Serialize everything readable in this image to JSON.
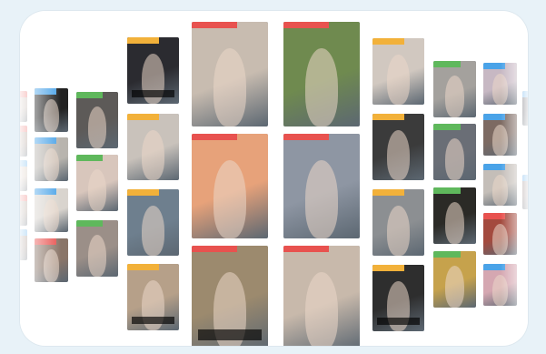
{
  "gallery": {
    "tiles": [
      {
        "name": "thumb-col0-1",
        "tag": "",
        "tag_color": "red",
        "bg": "#b7a59a"
      },
      {
        "name": "thumb-col0-2",
        "tag": "",
        "tag_color": "red",
        "bg": "#9a8074"
      },
      {
        "name": "thumb-col0-3",
        "tag": "",
        "tag_color": "blue",
        "bg": "#c9b6a7"
      },
      {
        "name": "thumb-col0-4",
        "tag": "",
        "tag_color": "red",
        "bg": "#a08d80"
      },
      {
        "name": "thumb-col0-5",
        "tag": "",
        "tag_color": "blue",
        "bg": "#8f7a6e"
      },
      {
        "name": "thumb-col1-1",
        "tag": "",
        "tag_color": "blue",
        "bg": "#222222"
      },
      {
        "name": "thumb-col1-2",
        "tag": "",
        "tag_color": "blue",
        "bg": "#b8b4ae"
      },
      {
        "name": "thumb-col1-3",
        "tag": "",
        "tag_color": "blue",
        "bg": "#d9d4ce"
      },
      {
        "name": "thumb-col1-4",
        "tag": "",
        "tag_color": "red",
        "bg": "#8a7568"
      },
      {
        "name": "thumb-col2-1",
        "tag": "",
        "tag_color": "green",
        "bg": "#5d5a58"
      },
      {
        "name": "thumb-col2-2",
        "tag": "",
        "tag_color": "green",
        "bg": "#d8c6bc"
      },
      {
        "name": "thumb-col2-3",
        "tag": "",
        "tag_color": "green",
        "bg": "#9b8f88"
      },
      {
        "name": "thumb-col3-1",
        "tag": "",
        "tag_color": "yellow",
        "bg": "#2b2b30",
        "caption": ""
      },
      {
        "name": "thumb-col3-2",
        "tag": "",
        "tag_color": "yellow",
        "bg": "#c9c2bb"
      },
      {
        "name": "thumb-col3-3",
        "tag": "",
        "tag_color": "yellow",
        "bg": "#6e7f8e"
      },
      {
        "name": "thumb-col3-4",
        "tag": "",
        "tag_color": "yellow",
        "bg": "#b6a089",
        "caption": ""
      },
      {
        "name": "thumb-col4-1",
        "tag": "",
        "tag_color": "red",
        "bg": "#c8bcb0"
      },
      {
        "name": "thumb-col4-2",
        "tag": "",
        "tag_color": "red",
        "bg": "#e7a27a"
      },
      {
        "name": "thumb-col4-3",
        "tag": "",
        "tag_color": "red",
        "bg": "#9c8a6e",
        "caption": ""
      },
      {
        "name": "thumb-col5-1",
        "tag": "",
        "tag_color": "red",
        "bg": "#6f8a4f"
      },
      {
        "name": "thumb-col5-2",
        "tag": "",
        "tag_color": "red",
        "bg": "#8e96a3"
      },
      {
        "name": "thumb-col5-3",
        "tag": "",
        "tag_color": "red",
        "bg": "#c8b9ab"
      },
      {
        "name": "thumb-col6-1",
        "tag": "",
        "tag_color": "yellow",
        "bg": "#d1c8c0"
      },
      {
        "name": "thumb-col6-2",
        "tag": "",
        "tag_color": "yellow",
        "bg": "#3b3b3b"
      },
      {
        "name": "thumb-col6-3",
        "tag": "",
        "tag_color": "yellow",
        "bg": "#8c8f92"
      },
      {
        "name": "thumb-col6-4",
        "tag": "",
        "tag_color": "yellow",
        "bg": "#2e2e2e",
        "caption": ""
      },
      {
        "name": "thumb-col7-1",
        "tag": "",
        "tag_color": "green",
        "bg": "#a4a19d"
      },
      {
        "name": "thumb-col7-2",
        "tag": "",
        "tag_color": "green",
        "bg": "#6a6e76"
      },
      {
        "name": "thumb-col7-3",
        "tag": "",
        "tag_color": "green",
        "bg": "#2b2a26"
      },
      {
        "name": "thumb-col7-4",
        "tag": "",
        "tag_color": "green",
        "bg": "#c6a24c"
      },
      {
        "name": "thumb-col8-1",
        "tag": "",
        "tag_color": "blue",
        "bg": "#c7b8c3"
      },
      {
        "name": "thumb-col8-2",
        "tag": "",
        "tag_color": "blue",
        "bg": "#7d6a62"
      },
      {
        "name": "thumb-col8-3",
        "tag": "",
        "tag_color": "blue",
        "bg": "#c4beb8"
      },
      {
        "name": "thumb-col8-4",
        "tag": "",
        "tag_color": "red",
        "bg": "#a34a3e"
      },
      {
        "name": "thumb-col8-5",
        "tag": "",
        "tag_color": "blue",
        "bg": "#d5a7b1"
      },
      {
        "name": "thumb-col9-1",
        "tag": "",
        "tag_color": "blue",
        "bg": "#3b3b45"
      },
      {
        "name": "thumb-col9-2",
        "tag": "",
        "tag_color": "blue",
        "bg": "#8d7b7b"
      }
    ]
  }
}
